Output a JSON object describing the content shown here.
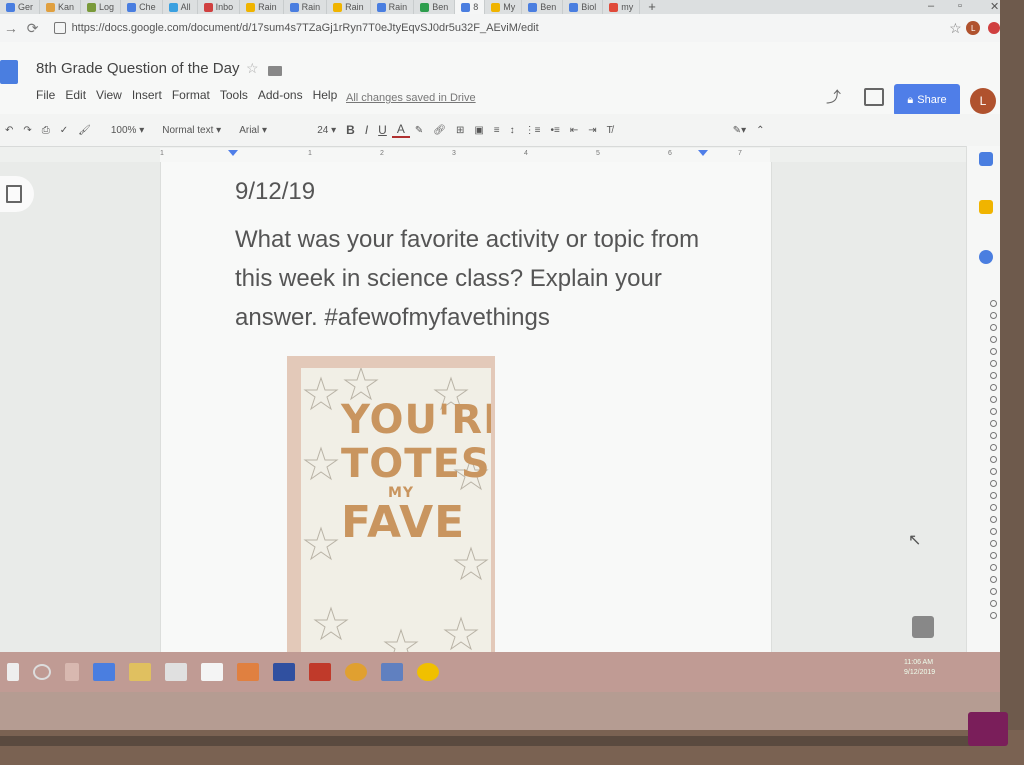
{
  "browser": {
    "tabs": [
      {
        "label": "Ger",
        "color": "#4a7ee0"
      },
      {
        "label": "Kan",
        "color": "#e0a040"
      },
      {
        "label": "Log",
        "color": "#7a9a3a"
      },
      {
        "label": "Che",
        "color": "#4a7ee0"
      },
      {
        "label": "All",
        "color": "#3aa0e0"
      },
      {
        "label": "Inbo",
        "color": "#d04040"
      },
      {
        "label": "Rain",
        "color": "#f0b400"
      },
      {
        "label": "Rain",
        "color": "#4a7ee0"
      },
      {
        "label": "Rain",
        "color": "#f0b400"
      },
      {
        "label": "Rain",
        "color": "#4a7ee0"
      },
      {
        "label": "Ben",
        "color": "#2e9e4e"
      },
      {
        "label": "8",
        "color": "#4a7ee0"
      },
      {
        "label": "My",
        "color": "#f0b400"
      },
      {
        "label": "Ben",
        "color": "#4a7ee0"
      },
      {
        "label": "Biol",
        "color": "#4a7ee0"
      },
      {
        "label": "my",
        "color": "#e04a3a"
      }
    ],
    "new_tab": "+",
    "url": "https://docs.google.com/document/d/17sum4s7TZaGj1rRyn7T0eJtyEqvSJ0dr5u32F_AEviM/edit",
    "avatar_letter": "L"
  },
  "docs": {
    "title": "8th Grade Question of the Day",
    "menu": [
      "File",
      "Edit",
      "View",
      "Insert",
      "Format",
      "Tools",
      "Add-ons",
      "Help"
    ],
    "save_status": "All changes saved in Drive",
    "share_label": "Share",
    "avatar_letter": "L"
  },
  "toolbar": {
    "zoom": "100%",
    "style": "Normal text",
    "font": "Arial",
    "size": "24",
    "bold": "B",
    "italic": "I",
    "underline": "U",
    "text_color": "A"
  },
  "ruler": [
    "1",
    "1",
    "2",
    "3",
    "4",
    "5",
    "6",
    "7"
  ],
  "document": {
    "date": "9/12/19",
    "question": "What was your favorite activity or topic from this week in science class? Explain your answer. #afewofmyfavethings",
    "card": {
      "line1": "YOU'RE",
      "line2": "TOTES",
      "line3": "MY",
      "line4": "FAVE"
    }
  },
  "taskbar": {
    "clock_time": "11:06 AM",
    "clock_date": "9/12/2019"
  }
}
